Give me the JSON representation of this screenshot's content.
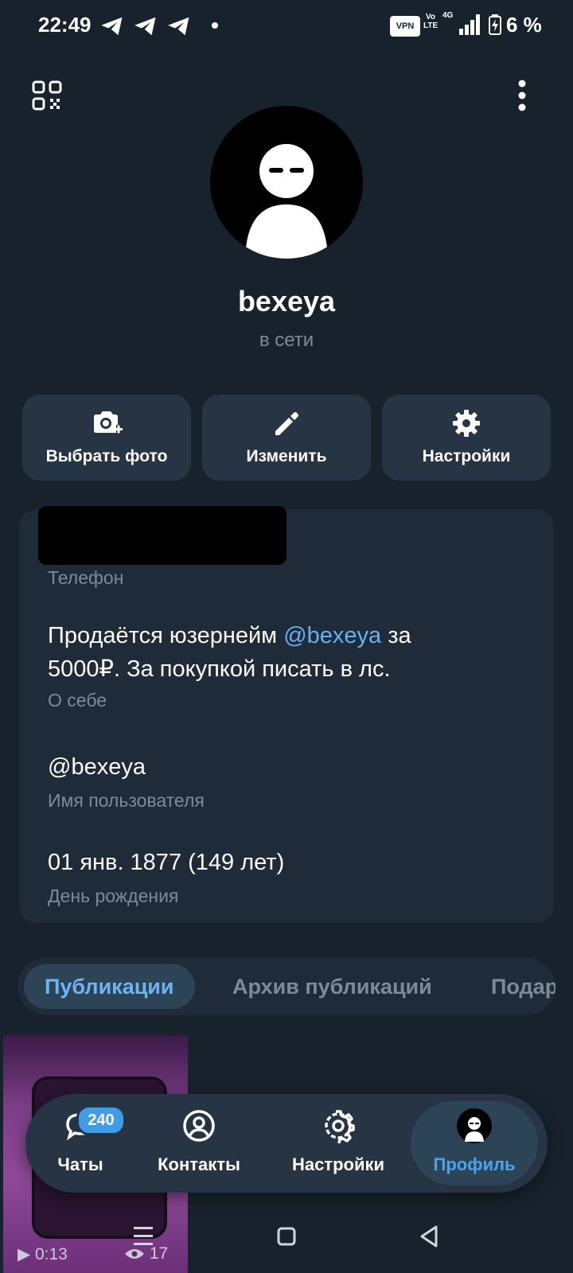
{
  "status_bar": {
    "time": "22:49",
    "vpn_label": "VPN",
    "volte_label": "Vo\nLTE",
    "network_label": "4G",
    "battery_percent": "6 %",
    "battery_level": 0.06
  },
  "profile": {
    "name": "bexeya",
    "online_status": "в сети"
  },
  "actions": [
    {
      "label": "Выбрать фото",
      "icon": "camera-add-icon"
    },
    {
      "label": "Изменить",
      "icon": "pencil-icon"
    },
    {
      "label": "Настройки",
      "icon": "gear-icon"
    }
  ],
  "info": {
    "phone_label": "Телефон",
    "bio_prefix": "Продаётся юзернейм ",
    "bio_link": "@bexeya",
    "bio_suffix": " за",
    "bio_line2": "5000₽. За покупкой писать в лс.",
    "bio_label": "О себе",
    "username": "@bexeya",
    "username_label": "Имя пользователя",
    "birthday": "01 янв. 1877 (149 лет)",
    "birthday_label": "День рождения"
  },
  "tabs": [
    {
      "label": "Публикации",
      "active": true
    },
    {
      "label": "Архив публикаций",
      "active": false
    },
    {
      "label": "Подар",
      "active": false
    }
  ],
  "media": {
    "duration": "0:13",
    "views": "17"
  },
  "bottom_nav": {
    "items": [
      {
        "label": "Чаты",
        "icon": "chats-icon",
        "badge": "240"
      },
      {
        "label": "Контакты",
        "icon": "contacts-icon"
      },
      {
        "label": "Настройки",
        "icon": "gear-icon"
      },
      {
        "label": "Профиль",
        "icon": "avatar-icon",
        "active": true
      }
    ]
  },
  "colors": {
    "background": "#18222d",
    "card": "#1f2b38",
    "button": "#263443",
    "accent": "#4da3ec",
    "link": "#68b0ee",
    "muted": "#7d8b99"
  }
}
